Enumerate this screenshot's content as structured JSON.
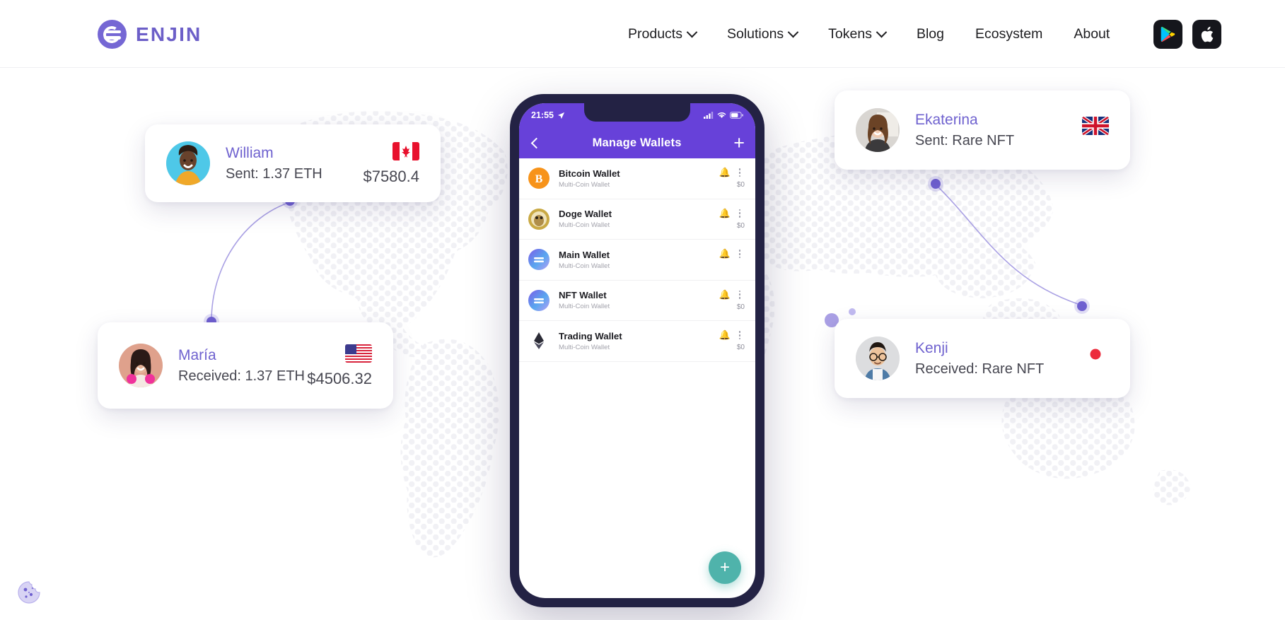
{
  "header": {
    "brand": "ENJIN",
    "nav": [
      {
        "label": "Products",
        "caret": true,
        "icon": "chevron-down-icon"
      },
      {
        "label": "Solutions",
        "caret": true,
        "icon": "chevron-down-icon"
      },
      {
        "label": "Tokens",
        "caret": true,
        "icon": "chevron-down-icon"
      },
      {
        "label": "Blog",
        "caret": false,
        "icon": ""
      },
      {
        "label": "Ecosystem",
        "caret": false,
        "icon": ""
      },
      {
        "label": "About",
        "caret": false,
        "icon": ""
      }
    ],
    "store_buttons": [
      {
        "name": "google-play-badge",
        "icon": "google-play-icon"
      },
      {
        "name": "app-store-badge",
        "icon": "apple-icon"
      }
    ]
  },
  "cards": [
    {
      "id": "william",
      "name": "William",
      "action": "Sent: 1.37 ETH",
      "amount": "$7580.4",
      "flag": "canada-flag",
      "avatar": "avatar-william"
    },
    {
      "id": "maria",
      "name": "María",
      "action": "Received: 1.37 ETH",
      "amount": "$4506.32",
      "flag": "usa-flag",
      "avatar": "avatar-maria"
    },
    {
      "id": "ekaterina",
      "name": "Ekaterina",
      "action": "Sent: Rare NFT",
      "amount": "",
      "flag": "uk-flag",
      "avatar": "avatar-ekaterina"
    },
    {
      "id": "kenji",
      "name": "Kenji",
      "action": "Received: Rare NFT",
      "amount": "",
      "flag": "japan-flag",
      "avatar": "avatar-kenji"
    }
  ],
  "phone": {
    "status": {
      "time": "21:55",
      "location_icon": "location-arrow-icon",
      "signal_icon": "cellular-signal-icon",
      "wifi_icon": "wifi-icon",
      "battery_icon": "battery-icon"
    },
    "appbar": {
      "back_icon": "back-arrow-icon",
      "title": "Manage Wallets",
      "add_label": "+"
    },
    "wallets": [
      {
        "title": "Bitcoin Wallet",
        "subtitle": "Multi-Coin Wallet",
        "balance": "$0",
        "coin": "bitcoin-coin-icon"
      },
      {
        "title": "Doge Wallet",
        "subtitle": "Multi-Coin Wallet",
        "balance": "$0",
        "coin": "dogecoin-coin-icon"
      },
      {
        "title": "Main Wallet",
        "subtitle": "Multi-Coin Wallet",
        "balance": "",
        "coin": "enjin-coin-icon"
      },
      {
        "title": "NFT Wallet",
        "subtitle": "Multi-Coin Wallet",
        "balance": "$0",
        "coin": "enjin-coin-icon"
      },
      {
        "title": "Trading Wallet",
        "subtitle": "Multi-Coin Wallet",
        "balance": "$0",
        "coin": "ethereum-coin-icon"
      }
    ],
    "fab_label": "+"
  },
  "cookie": {
    "icon": "cookie-icon"
  },
  "colors": {
    "brand_purple": "#6c5fc8",
    "appbar_purple": "#6741d9",
    "phone_frame": "#232244",
    "fab_teal": "#4fb3ab",
    "card_name": "#6f62cf",
    "map_dot": "#f0f0f4",
    "arc_line": "#8d83d8"
  }
}
